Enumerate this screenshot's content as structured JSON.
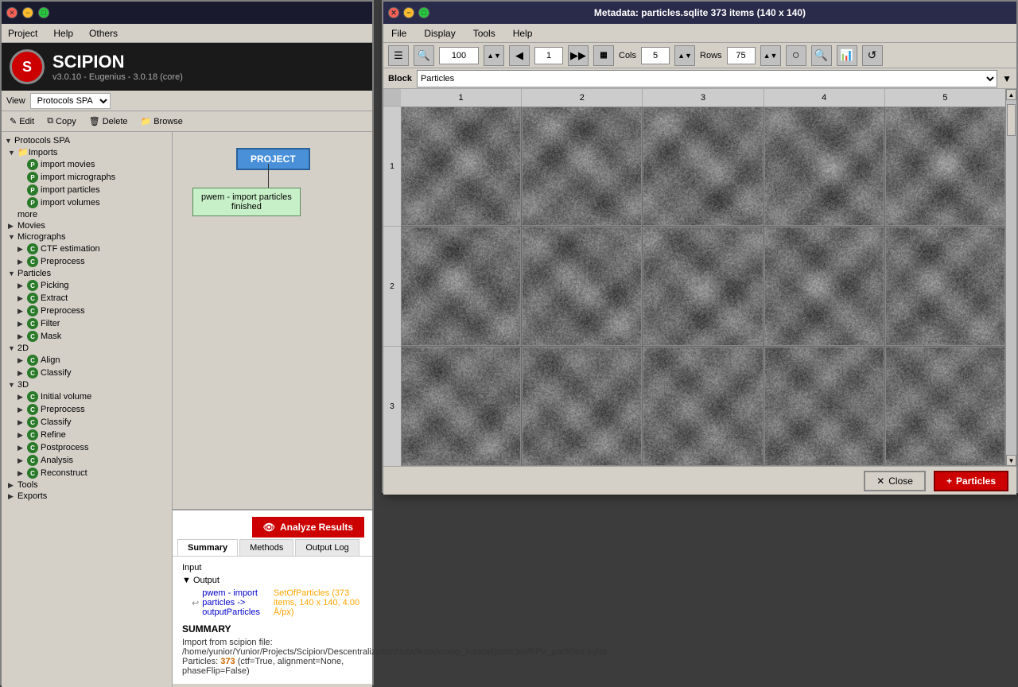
{
  "main_window": {
    "title": "Scipion",
    "version": "v3.0.10 - Eugenius - 3.0.18 (core)",
    "menus": [
      "Project",
      "Help",
      "Others"
    ],
    "view_label": "View",
    "view_options": [
      "Protocols SPA"
    ],
    "toolbar_buttons": [
      "Edit",
      "Copy",
      "Delete",
      "Browse"
    ]
  },
  "sidebar": {
    "items": [
      {
        "label": "Protocols SPA",
        "level": 0,
        "arrow": "▼",
        "icon": null
      },
      {
        "label": "Imports",
        "level": 1,
        "arrow": "▼",
        "icon": "folder"
      },
      {
        "label": "import movies",
        "level": 2,
        "arrow": "",
        "icon": "green",
        "letter": "P"
      },
      {
        "label": "import micrographs",
        "level": 2,
        "arrow": "",
        "icon": "green",
        "letter": "P"
      },
      {
        "label": "import particles",
        "level": 2,
        "arrow": "",
        "icon": "green",
        "letter": "P"
      },
      {
        "label": "import volumes",
        "level": 2,
        "arrow": "",
        "icon": "green",
        "letter": "P"
      },
      {
        "label": "more",
        "level": 2,
        "arrow": "",
        "icon": null
      },
      {
        "label": "Movies",
        "level": 1,
        "arrow": "▶",
        "icon": null
      },
      {
        "label": "Micrographs",
        "level": 1,
        "arrow": "▼",
        "icon": null
      },
      {
        "label": "CTF estimation",
        "level": 2,
        "arrow": "▶",
        "icon": "green",
        "letter": "C"
      },
      {
        "label": "Preprocess",
        "level": 2,
        "arrow": "▶",
        "icon": "green",
        "letter": "C"
      },
      {
        "label": "Particles",
        "level": 1,
        "arrow": "▼",
        "icon": null
      },
      {
        "label": "Picking",
        "level": 2,
        "arrow": "▶",
        "icon": "green",
        "letter": "C"
      },
      {
        "label": "Extract",
        "level": 2,
        "arrow": "▶",
        "icon": "green",
        "letter": "C"
      },
      {
        "label": "Preprocess",
        "level": 2,
        "arrow": "▶",
        "icon": "green",
        "letter": "C"
      },
      {
        "label": "Filter",
        "level": 2,
        "arrow": "▶",
        "icon": "green",
        "letter": "C"
      },
      {
        "label": "Mask",
        "level": 2,
        "arrow": "▶",
        "icon": "green",
        "letter": "C"
      },
      {
        "label": "2D",
        "level": 1,
        "arrow": "▼",
        "icon": null
      },
      {
        "label": "Align",
        "level": 2,
        "arrow": "▶",
        "icon": "green",
        "letter": "C"
      },
      {
        "label": "Classify",
        "level": 2,
        "arrow": "▶",
        "icon": "green",
        "letter": "C"
      },
      {
        "label": "3D",
        "level": 1,
        "arrow": "▼",
        "icon": null
      },
      {
        "label": "Initial volume",
        "level": 2,
        "arrow": "▶",
        "icon": "green",
        "letter": "C"
      },
      {
        "label": "Preprocess",
        "level": 2,
        "arrow": "▶",
        "icon": "green",
        "letter": "C"
      },
      {
        "label": "Classify",
        "level": 2,
        "arrow": "▶",
        "icon": "green",
        "letter": "C"
      },
      {
        "label": "Refine",
        "level": 2,
        "arrow": "▶",
        "icon": "green",
        "letter": "C"
      },
      {
        "label": "Postprocess",
        "level": 2,
        "arrow": "▶",
        "icon": "green",
        "letter": "C"
      },
      {
        "label": "Analysis",
        "level": 2,
        "arrow": "▶",
        "icon": "green",
        "letter": "C"
      },
      {
        "label": "Reconstruct",
        "level": 2,
        "arrow": "▶",
        "icon": "green",
        "letter": "C"
      },
      {
        "label": "Tools",
        "level": 1,
        "arrow": "▶",
        "icon": null
      },
      {
        "label": "Exports",
        "level": 1,
        "arrow": "▶",
        "icon": null
      }
    ]
  },
  "workflow": {
    "project_node": "PROJECT",
    "protocol_node_label": "pwem - import particles\nfinished"
  },
  "bottom_panel": {
    "analyze_btn": "Analyze Results",
    "tabs": [
      "Summary",
      "Methods",
      "Output Log"
    ],
    "active_tab": "Summary",
    "input_label": "Input",
    "output_label": "Output",
    "output_link": "pwem - import particles -> outputParticles",
    "output_stats": "SetOfParticles (373 items, 140 x 140, 4.00 Å/px)",
    "summary_heading": "SUMMARY",
    "summary_line1": "Import from scipion file:",
    "summary_line2": "/home/yunior/Yunior/Projects/Scipion/Descentralization/data/tests/xmipp_tutorial/particles/BPV_particles.sqlite",
    "summary_line3": "Particles: 373 (ctf=True, alignment=None, phaseFlip=False)"
  },
  "metadata_window": {
    "title": "Metadata: particles.sqlite 373 items (140 x 140)",
    "menus": [
      "File",
      "Display",
      "Tools",
      "Help"
    ],
    "zoom_value": "100",
    "page_value": "1",
    "cols_value": "5",
    "rows_value": "75",
    "block_label": "Block",
    "block_value": "Particles",
    "col_headers": [
      "1",
      "2",
      "3",
      "4",
      "5"
    ],
    "row_labels": [
      "1",
      "2",
      "3"
    ],
    "btn_close": "Close",
    "btn_particles": "Particles",
    "grid_rows": 3,
    "grid_cols": 5
  }
}
